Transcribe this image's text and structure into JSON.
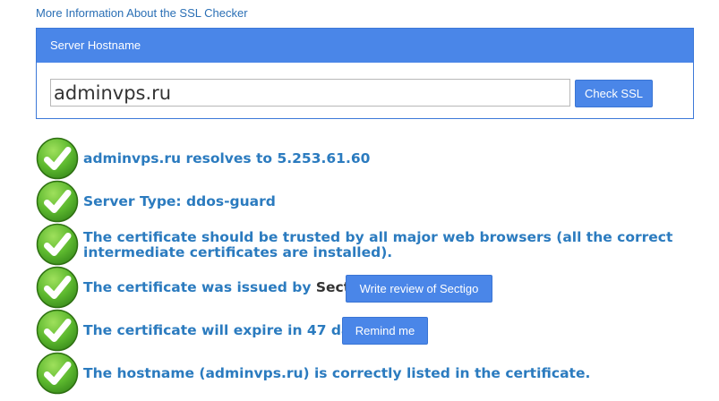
{
  "top_link": "More Information About the SSL Checker",
  "panel": {
    "header": "Server Hostname",
    "input_value": "adminvps.ru",
    "check_button": "Check SSL"
  },
  "results": [
    {
      "text": "adminvps.ru resolves to 5.253.61.60"
    },
    {
      "text": "Server Type: ddos-guard"
    },
    {
      "text": "The certificate should be trusted by all major web browsers (all the correct intermediate certificates are installed)."
    },
    {
      "text": "The certificate was issued by",
      "vendor": "Sectigo",
      "suffix": ".",
      "button": "Write review of Sectigo"
    },
    {
      "text": "The certificate will expire in 47 days.",
      "button": "Remind me"
    },
    {
      "text": "The hostname (adminvps.ru) is correctly listed in the certificate."
    }
  ],
  "icon": "check-icon",
  "colors": {
    "accent": "#4a86e8",
    "result_text": "#2b7bbf",
    "check_green": "#5cb82e"
  }
}
